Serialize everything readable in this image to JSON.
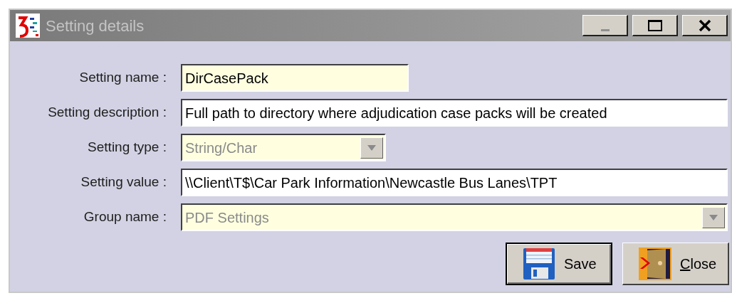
{
  "window": {
    "title": "Setting details"
  },
  "title_buttons": [
    {
      "kind": "minimize"
    },
    {
      "kind": "maximize"
    },
    {
      "kind": "close"
    }
  ],
  "fields": [
    {
      "label": "Setting name :",
      "kind": "text",
      "value": "DirCasePack",
      "readonly": true,
      "disabled": false
    },
    {
      "label": "Setting description :",
      "kind": "text",
      "value": "Full path to directory where adjudication case packs will be created",
      "readonly": false,
      "disabled": false
    },
    {
      "label": "Setting type :",
      "kind": "dropdown",
      "value": "String/Char",
      "disabled": true
    },
    {
      "label": "Setting value :",
      "kind": "text",
      "value": "\\\\Client\\T$\\Car Park Information\\Newcastle Bus Lanes\\TPT",
      "readonly": false,
      "disabled": false
    },
    {
      "label": "Group name :",
      "kind": "dropdown",
      "value": "PDF Settings",
      "disabled": true
    }
  ],
  "buttons": [
    {
      "kind": "save",
      "label": "Save",
      "default": true,
      "first_letter_underlined": false
    },
    {
      "kind": "close",
      "label": "Close",
      "default": false,
      "first_letter_underlined": true
    }
  ]
}
